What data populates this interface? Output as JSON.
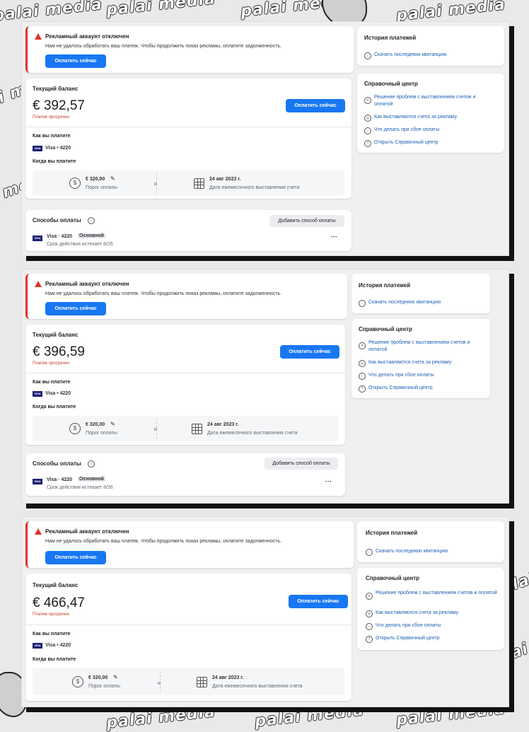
{
  "watermark": "palai media",
  "screens": [
    {
      "alert": {
        "title": "Рекламный аккаунт отключен",
        "message": "Нам не удалось обработать ваш платеж. Чтобы продолжить показ рекламы, оплатите задолженность.",
        "button": "Оплатить сейчас"
      },
      "balance": {
        "heading": "Текущий баланс",
        "amount": "€ 392,57",
        "status": "Платеж просрочен",
        "pay_button": "Оплатить сейчас",
        "how_heading": "Как вы платите",
        "card": "Visa • 4220",
        "when_heading": "Когда вы платите",
        "threshold_value": "€ 320,00",
        "threshold_label": "Порог оплаты",
        "and": "и",
        "date_value": "24 авг 2023 г.",
        "date_label": "Дата ежемесячного выставления счета"
      },
      "methods": {
        "heading": "Способы оплаты",
        "add_button": "Добавить способ оплаты",
        "card": "Visa · 4220",
        "badge": "Основной",
        "expiry": "Срок действия истекает 8/26",
        "more": "•••"
      },
      "history": {
        "heading": "История платежей",
        "link": "Скачать последнюю квитанцию"
      },
      "help": {
        "heading": "Справочный центр",
        "links": [
          "Решение проблем с выставлением счетов и оплатой",
          "Как выставляются счета за рекламу",
          "Что делать при сбое оплаты",
          "Открыть Справочный центр"
        ]
      }
    },
    {
      "alert": {
        "title": "Рекламный аккаунт отключен",
        "message": "Нам не удалось обработать ваш платеж. Чтобы продолжить показ рекламы, оплатите задолженность.",
        "button": "Оплатить сейчас"
      },
      "balance": {
        "heading": "Текущий баланс",
        "amount": "€ 396,59",
        "status": "Платеж просрочен",
        "pay_button": "Оплатить сейчас",
        "how_heading": "Как вы платите",
        "card": "Visa • 4220",
        "when_heading": "Когда вы платите",
        "threshold_value": "€ 320,00",
        "threshold_label": "Порог оплаты",
        "and": "и",
        "date_value": "24 авг 2023 г.",
        "date_label": "Дата ежемесячного выставления счета"
      },
      "methods": {
        "heading": "Способы оплаты",
        "add_button": "Добавить способ оплаты",
        "card": "Visa · 4220",
        "badge": "Основной",
        "expiry": "Срок действия истекает 8/26",
        "more": "•••"
      },
      "history": {
        "heading": "История платежей",
        "link": "Скачать последнюю квитанцию"
      },
      "help": {
        "heading": "Справочный центр",
        "links": [
          "Решение проблем с выставлением счетов и оплатой",
          "Как выставляются счета за рекламу",
          "Что делать при сбое оплаты",
          "Открыть Справочный центр"
        ]
      }
    },
    {
      "alert": {
        "title": "Рекламный аккаунт отключен",
        "message": "Нам не удалось обработать ваш платеж. Чтобы продолжить показ рекламы, оплатите задолженность.",
        "button": "Оплатить сейчас"
      },
      "balance": {
        "heading": "Текущий баланс",
        "amount": "€ 466,47",
        "status": "Платеж просрочен",
        "pay_button": "Оплатить сейчас",
        "how_heading": "Как вы платите",
        "card": "Visa • 4220",
        "when_heading": "Когда вы платите",
        "threshold_value": "€ 320,00",
        "threshold_label": "Порог оплаты",
        "and": "и",
        "date_value": "24 авг 2023 г.",
        "date_label": "Дата ежемесячного выставления счета"
      },
      "history": {
        "heading": "История платежей",
        "link": "Скачать последнюю квитанцию"
      },
      "help": {
        "heading": "Справочный центр",
        "links": [
          "Решение проблем с выставлением счетов и оплатой",
          "Как выставляются счета за рекламу",
          "Что делать при сбое оплаты",
          "Открыть Справочный центр"
        ]
      }
    }
  ]
}
